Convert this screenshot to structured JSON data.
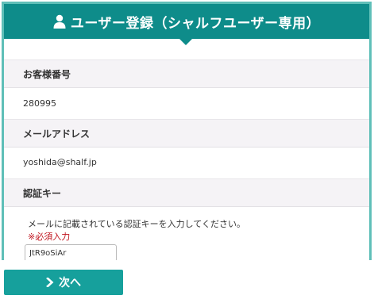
{
  "header": {
    "title": "ユーザー登録（シャルフユーザー専用）",
    "icon": "user-icon",
    "color": "#0e8c8a"
  },
  "fields": {
    "customer_number": {
      "label": "お客様番号",
      "value": "280995"
    },
    "email": {
      "label": "メールアドレス",
      "value": "yoshida@shalf.jp"
    },
    "auth_key": {
      "label": "認証キー",
      "description": "メールに記載されている認証キーを入力してください。",
      "required_note": "※必須入力",
      "input_value": "JtR9oSiAr"
    }
  },
  "actions": {
    "next_label": "次へ",
    "next_icon": "chevron-right-icon",
    "button_color": "#16a09c"
  },
  "colors": {
    "border": "#5fbfb8",
    "section_bg": "#f5f3f6",
    "required": "#c0141e"
  }
}
